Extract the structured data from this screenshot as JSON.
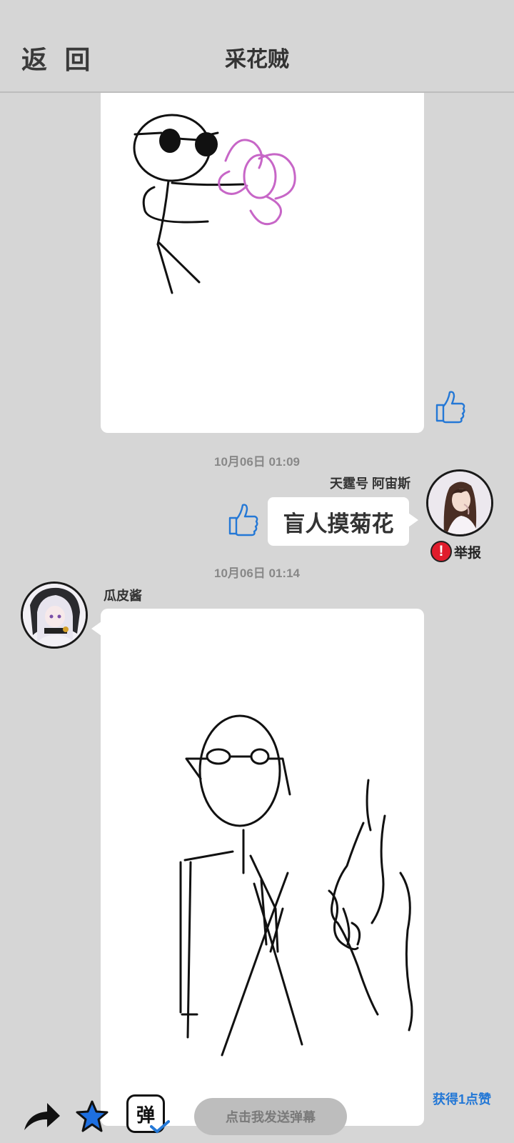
{
  "header": {
    "back_label": "返 回",
    "title": "采花贼"
  },
  "messages": [
    {
      "type": "drawing",
      "image": "stick figure picking a pink flower",
      "liked": false
    },
    {
      "type": "text",
      "timestamp": "10月06日  01:09",
      "username": "天霆号 阿宙斯",
      "text": "盲人摸菊花",
      "report_label": "举报"
    },
    {
      "type": "drawing",
      "timestamp": "10月06日  01:14",
      "username": "瓜皮酱",
      "image": "stick figure with glasses and a hand sketch"
    }
  ],
  "footer": {
    "share_icon": "share-arrow-icon",
    "favorite_icon": "star-icon",
    "danmaku_icon_label": "弹",
    "danmaku_placeholder": "点击我发送弹幕",
    "likes_earned": "获得1点赞"
  },
  "colors": {
    "background": "#d6d6d6",
    "accent_blue": "#2478d6",
    "star_blue": "#1e6fe0",
    "flower_pink": "#c766c7",
    "report_red": "#e01c2c"
  }
}
